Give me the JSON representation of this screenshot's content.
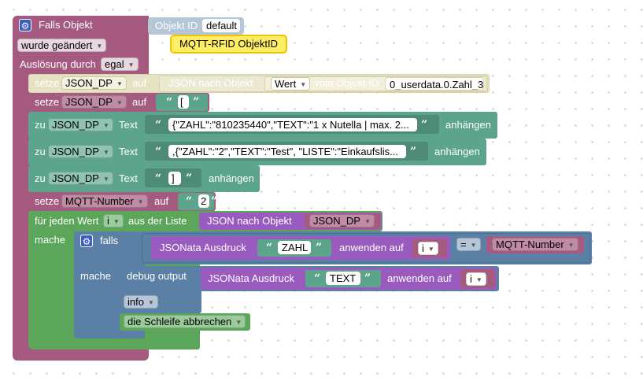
{
  "colors": {
    "event": "#a5597e",
    "event_light": "#b27292",
    "var": "#a55b80",
    "text": "#5ca58c",
    "text_dark": "#4d8b76",
    "loop": "#5ca65c",
    "logic": "#5b80a5",
    "json": "#9a5bbf",
    "debug": "#5b80a5",
    "id": "#b4c6d8",
    "shadow_block": "#e6e2c4",
    "mqtt_label": "#ffee88"
  },
  "event": {
    "title": "Falls Objekt",
    "id_label": "Objekt ID",
    "id_value": "default",
    "changed": "wurde geändert",
    "trigger_label": "Auslösung durch",
    "trigger_value": "egal"
  },
  "mqtt_label": "MQTT-RFID ObjektID",
  "set1": {
    "set": "setze",
    "var": "JSON_DP",
    "to": "auf",
    "json_parse": "JSON nach Objekt",
    "value": "Wert",
    "from": "vom Objekt ID",
    "object_id": "0_userdata.0.Zahl_3"
  },
  "set2": {
    "set": "setze",
    "var": "JSON_DP",
    "to": "auf",
    "text": "["
  },
  "append1": {
    "prefix": "zu",
    "var": "JSON_DP",
    "text_label": "Text",
    "text": "{\"ZAHL\":\"810235440\",\"TEXT\":\"1 x Nutella | max. 2...",
    "suffix": "anhängen"
  },
  "append2": {
    "prefix": "zu",
    "var": "JSON_DP",
    "text_label": "Text",
    "text": ",{\"ZAHL\":\"2\",\"TEXT\":\"Test\", \"LISTE\":\"Einkaufslis...",
    "suffix": "anhängen"
  },
  "append3": {
    "prefix": "zu",
    "var": "JSON_DP",
    "text_label": "Text",
    "text": "]",
    "suffix": "anhängen"
  },
  "set3": {
    "set": "setze",
    "var": "MQTT-Number",
    "to": "auf",
    "text": "2"
  },
  "foreach": {
    "label": "für jeden Wert",
    "var": "i",
    "from_list": "aus der Liste",
    "json_parse": "JSON nach Objekt",
    "list_var": "JSON_DP",
    "do": "mache"
  },
  "ifblock": {
    "if": "falls",
    "do": "mache",
    "jsonata": "JSONata Ausdruck",
    "expr": "ZAHL",
    "apply": "anwenden auf",
    "var": "i",
    "op": "=",
    "compare_var": "MQTT-Number"
  },
  "debug": {
    "label": "debug output",
    "jsonata": "JSONata Ausdruck",
    "expr": "TEXT",
    "apply": "anwenden auf",
    "var": "i",
    "level": "info"
  },
  "break_loop": "die Schleife abbrechen",
  "quote_open": "“",
  "quote_close": "”",
  "gear_icon": "⚙",
  "caret": "▼"
}
